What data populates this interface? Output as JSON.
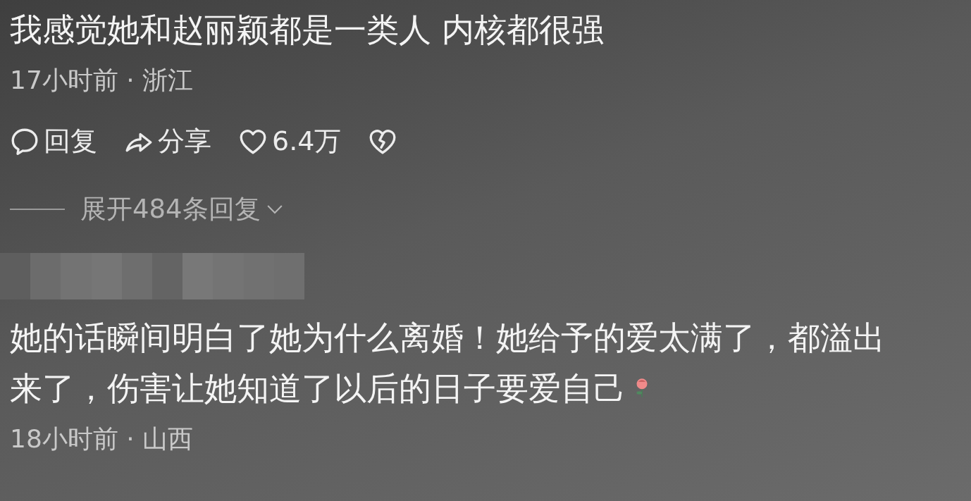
{
  "comments": [
    {
      "text": "我感觉她和赵丽颖都是一类人 内核都很强",
      "meta": "17小时前 · 浙江",
      "actions": [
        {
          "kind": "reply",
          "label": "回复"
        },
        {
          "kind": "share",
          "label": "分享"
        },
        {
          "kind": "like",
          "label": "6.4万"
        },
        {
          "kind": "dislike"
        }
      ],
      "expand": "展开484条回复"
    },
    {
      "username_redacted": true,
      "text_lines": [
        "她的话瞬间明白了她为什么离婚！她给予的爱太满了，都溢出",
        "来了，伤害让她知道了以后的日子要爱自己"
      ],
      "meta": "18小时前 · 山西"
    }
  ]
}
